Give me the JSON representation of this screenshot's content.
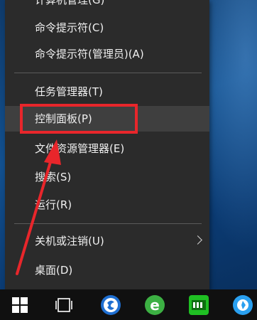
{
  "menu": {
    "items": [
      {
        "label": "计算机管理(G)"
      },
      {
        "label": "命令提示符(C)"
      },
      {
        "label": "命令提示符(管理员)(A)"
      },
      {
        "label": "任务管理器(T)"
      },
      {
        "label": "控制面板(P)"
      },
      {
        "label": "文件资源管理器(E)"
      },
      {
        "label": "搜索(S)"
      },
      {
        "label": "运行(R)"
      },
      {
        "label": "关机或注销(U)"
      },
      {
        "label": "桌面(D)"
      }
    ]
  },
  "annotation": {
    "color": "#e8262b",
    "highlighted_item": "控制面板(P)"
  },
  "taskbar": {
    "icons": [
      "windows-start-icon",
      "task-view-icon",
      "sogou-browser-icon",
      "ie-style-browser-icon",
      "iqiyi-icon",
      "blue-app-icon"
    ]
  }
}
